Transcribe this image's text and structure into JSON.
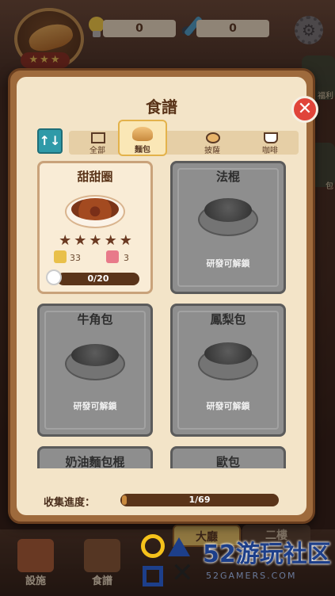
{
  "hud": {
    "idea_count": "0",
    "paint_count": "0",
    "badge_stars": "★★★",
    "side_button_label_1": "福利",
    "side_button_label_2": "包"
  },
  "recipe_book": {
    "title": "食譜",
    "sort_icon": "↑↓",
    "close_icon": "✕",
    "tabs": [
      {
        "label": "全部",
        "icon": "grid-icon"
      },
      {
        "label": "麵包",
        "icon": "bread-icon",
        "active": true
      },
      {
        "label": "披薩",
        "icon": "pizza-icon"
      },
      {
        "label": "咖啡",
        "icon": "coffee-icon"
      }
    ],
    "cards": [
      {
        "name": "甜甜圈",
        "unlocked": true,
        "stars": "★★★★★",
        "likes_left": "33",
        "likes_right": "3",
        "progress": "0/20"
      },
      {
        "name": "法棍",
        "unlocked": false,
        "lock_text": "研發可解鎖"
      },
      {
        "name": "牛角包",
        "unlocked": false,
        "lock_text": "研發可解鎖"
      },
      {
        "name": "鳳梨包",
        "unlocked": false,
        "lock_text": "研發可解鎖"
      },
      {
        "name": "奶油麵包棍",
        "unlocked": false
      },
      {
        "name": "歐包",
        "unlocked": false
      }
    ],
    "collect_label": "收集進度：",
    "collect_value": "1/69",
    "collect_fraction": 0.0145
  },
  "bottom_nav": {
    "items": [
      {
        "label": "設施"
      },
      {
        "label": "食譜"
      }
    ],
    "floor_tabs": [
      "大廳",
      "二樓"
    ]
  },
  "watermark": {
    "text": "52游玩社区",
    "url": "52GAMERS.COM"
  }
}
